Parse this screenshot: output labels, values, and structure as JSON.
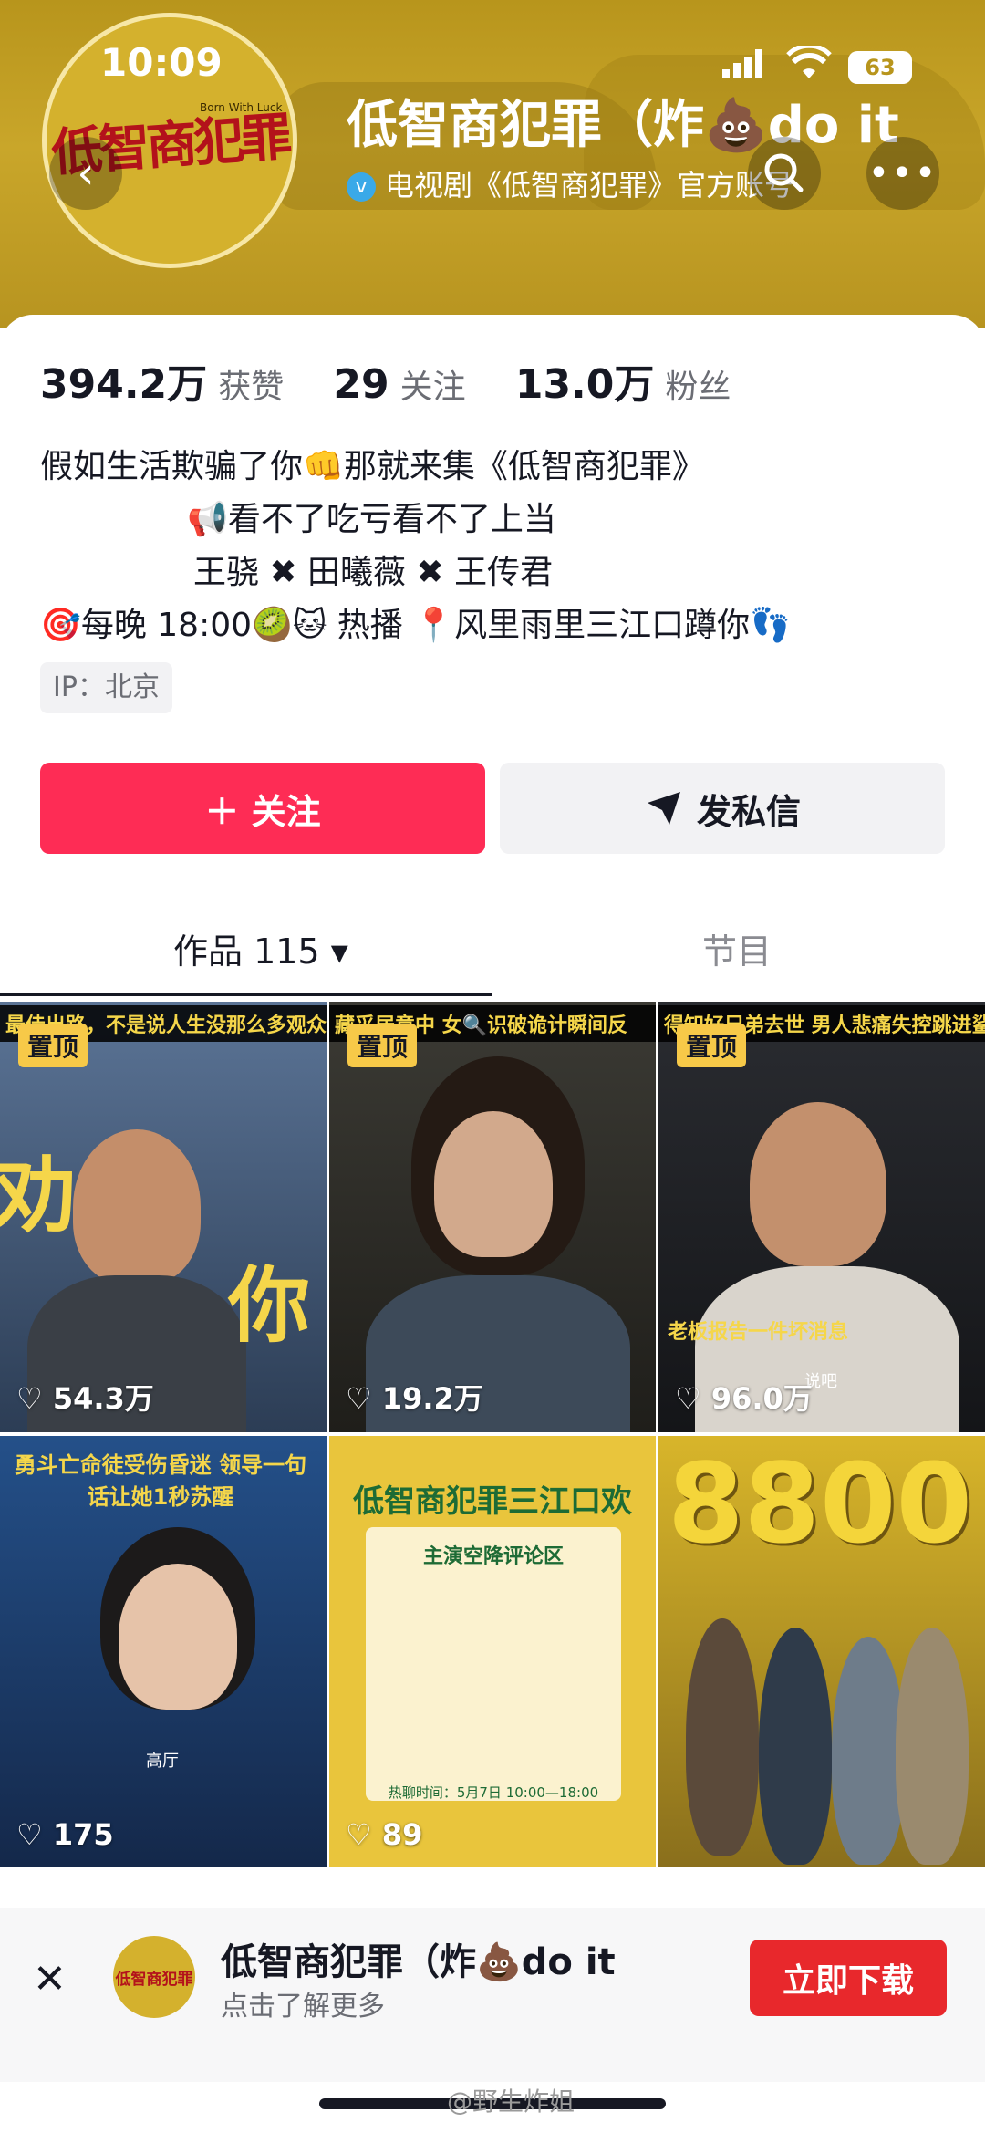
{
  "status_bar": {
    "time": "10:09",
    "battery": "63"
  },
  "header": {
    "title": "低智商犯罪（炸💩do it",
    "verify_text": "电视剧《低智商犯罪》官方账号",
    "logo_text": "低智商犯罪",
    "logo_sub": "Born With Luck"
  },
  "stats": [
    {
      "num": "394.2万",
      "label": "获赞"
    },
    {
      "num": "29",
      "label": "关注"
    },
    {
      "num": "13.0万",
      "label": "粉丝"
    }
  ],
  "bio": [
    "假如生活欺骗了你👊那就来集《低智商犯罪》",
    "📢看不了吃亏看不了上当",
    "王骁 ✖ 田曦薇 ✖ 王传君",
    "🎯每晚 18:00🥝🐱 热播 📍风里雨里三江口蹲你👣"
  ],
  "ip": "IP：北京",
  "buttons": {
    "follow": "＋ 关注",
    "message": "发私信"
  },
  "tabs": {
    "works": "作品 115 ▾",
    "shows": "节目"
  },
  "pin_label": "置顶",
  "tiles": [
    {
      "banner": "最佳出路，不是说人生没那么多观众的么",
      "likes": "54.3万",
      "bg": "#3c5577"
    },
    {
      "banner": "藏采居意中 女🔍识破诡计瞬间反",
      "likes": "19.2万",
      "bg": "#2b2a26"
    },
    {
      "banner": "得知好兄弟去世 男人悲痛失控跳进鲨鱼",
      "likes": "96.0万",
      "bg": "#1e2024"
    },
    {
      "banner": "勇斗亡命徒受伤昏迷 领导一句话让她1秒苏醒",
      "likes": "175",
      "bg": "#1f3a66"
    },
    {
      "banner": "低智商犯罪三江口欢乐局",
      "likes": "89",
      "bg": "#e9c53c"
    },
    {
      "banner": "8800",
      "likes": "",
      "bg": "#d8b52a"
    }
  ],
  "tile_captions": {
    "t3": "老板报告一件坏消息",
    "t3b": "说吧",
    "t4": "高厅",
    "t5a": "主演空降评论区",
    "t5b": "热聊时间：5月7日 10:00—18:00"
  },
  "download_bar": {
    "title": "低智商犯罪（炸💩do it",
    "subtitle": "点击了解更多",
    "button": "立即下载"
  },
  "watermark": "@野生炸姐",
  "colors": {
    "accent": "#fe2c55",
    "download": "#e8282c",
    "header": "#c9a62a"
  }
}
